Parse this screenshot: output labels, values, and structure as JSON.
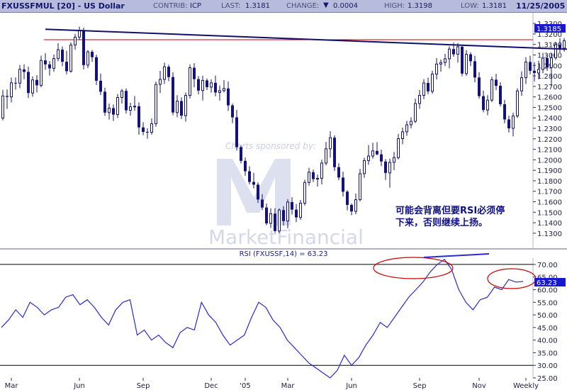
{
  "header": {
    "symbol": "FXUSSFMUL [20] - US Dollar",
    "contrib_label": "CONTRIB:",
    "contrib_value": "ICP",
    "last_label": "LAST:",
    "last_value": "1.3181",
    "change_label": "CHANGE:",
    "change_value": "0.0004",
    "high_label": "HIGH:",
    "high_value": "1.3198",
    "low_label": "LOW:",
    "low_value": "1.3181",
    "date": "11/25/2005"
  },
  "watermark": {
    "sponsor": "Charts sponsored by:",
    "brand": "MarketFinancial"
  },
  "annotation": {
    "line1": "可能会背离但要RSI必须停",
    "line2": "下来，否则继续上扬。"
  },
  "colors": {
    "candle": "#12127a",
    "resistance": "#cc0000",
    "trendline": "#10106a",
    "rsi_line": "#2a2ad0",
    "ellipse": "#cc0000",
    "header_bg": "#b8bcdc",
    "price_box": "#1818cc"
  },
  "chart_data": [
    {
      "type": "candlestick",
      "title": "FXUSSFMUL [20] - US Dollar",
      "ylim": [
        1.1225,
        1.3375
      ],
      "yticks": [
        "1.3300",
        "1.3200",
        "1.3100",
        "1.3000",
        "1.2900",
        "1.2800",
        "1.2700",
        "1.2600",
        "1.2500",
        "1.2400",
        "1.2300",
        "1.2200",
        "1.2100",
        "1.2000",
        "1.1900",
        "1.1800",
        "1.1700",
        "1.1600",
        "1.1500",
        "1.1400",
        "1.1300"
      ],
      "current_price_label": "1.3185",
      "resistance_level": 1.3145,
      "trendline": {
        "from_index": 10,
        "from_value": 1.3245,
        "to_index": 149,
        "to_value": 1.3029
      },
      "ohlc": [
        [
          1.2398,
          1.2668,
          1.2376,
          1.2609
        ],
        [
          1.2609,
          1.2671,
          1.2486,
          1.26
        ],
        [
          1.26,
          1.2784,
          1.2547,
          1.2734
        ],
        [
          1.2734,
          1.2786,
          1.2669,
          1.2731
        ],
        [
          1.2731,
          1.2905,
          1.2682,
          1.2862
        ],
        [
          1.2862,
          1.2911,
          1.2768,
          1.2838
        ],
        [
          1.2838,
          1.2889,
          1.2589,
          1.2637
        ],
        [
          1.2637,
          1.2795,
          1.2602,
          1.2762
        ],
        [
          1.2762,
          1.2807,
          1.2643,
          1.271
        ],
        [
          1.271,
          1.2993,
          1.2691,
          1.2948
        ],
        [
          1.2948,
          1.3017,
          1.2858,
          1.291
        ],
        [
          1.291,
          1.2942,
          1.2803,
          1.2872
        ],
        [
          1.2872,
          1.3003,
          1.2841,
          1.2965
        ],
        [
          1.2965,
          1.3111,
          1.2941,
          1.305
        ],
        [
          1.305,
          1.3081,
          1.2893,
          1.2935
        ],
        [
          1.2935,
          1.304,
          1.2815,
          1.2845
        ],
        [
          1.2845,
          1.312,
          1.283,
          1.3095
        ],
        [
          1.3095,
          1.3201,
          1.305,
          1.317
        ],
        [
          1.317,
          1.327,
          1.3143,
          1.3235
        ],
        [
          1.3235,
          1.326,
          1.2862,
          1.2903
        ],
        [
          1.2903,
          1.3046,
          1.2874,
          1.303
        ],
        [
          1.303,
          1.3047,
          1.2934,
          1.2978
        ],
        [
          1.2978,
          1.3003,
          1.2714,
          1.2754
        ],
        [
          1.2754,
          1.2822,
          1.2618,
          1.2649
        ],
        [
          1.2649,
          1.2687,
          1.2419,
          1.245
        ],
        [
          1.245,
          1.2536,
          1.2383,
          1.2493
        ],
        [
          1.2493,
          1.2528,
          1.2371,
          1.2431
        ],
        [
          1.2431,
          1.2627,
          1.2398,
          1.2594
        ],
        [
          1.2594,
          1.2674,
          1.2537,
          1.2657
        ],
        [
          1.2657,
          1.2681,
          1.2442,
          1.2472
        ],
        [
          1.2472,
          1.2543,
          1.2421,
          1.2505
        ],
        [
          1.2505,
          1.2608,
          1.2467,
          1.2511
        ],
        [
          1.2511,
          1.2548,
          1.2239,
          1.2309
        ],
        [
          1.2309,
          1.2358,
          1.2236,
          1.2266
        ],
        [
          1.2266,
          1.2301,
          1.2201,
          1.2262
        ],
        [
          1.2262,
          1.2395,
          1.224,
          1.2344
        ],
        [
          1.2344,
          1.2746,
          1.2315,
          1.2719
        ],
        [
          1.2719,
          1.2848,
          1.2636,
          1.2767
        ],
        [
          1.2767,
          1.2926,
          1.2723,
          1.2887
        ],
        [
          1.2887,
          1.2907,
          1.275,
          1.2789
        ],
        [
          1.2789,
          1.2835,
          1.2425,
          1.2451
        ],
        [
          1.2451,
          1.2616,
          1.2406,
          1.256
        ],
        [
          1.256,
          1.2596,
          1.2389,
          1.2421
        ],
        [
          1.2421,
          1.2642,
          1.2364,
          1.2614
        ],
        [
          1.2614,
          1.291,
          1.2585,
          1.2878
        ],
        [
          1.2878,
          1.2921,
          1.2692,
          1.2769
        ],
        [
          1.2769,
          1.2799,
          1.2624,
          1.266
        ],
        [
          1.266,
          1.2802,
          1.2566,
          1.2757
        ],
        [
          1.2757,
          1.2776,
          1.2664,
          1.2693
        ],
        [
          1.2693,
          1.2767,
          1.264,
          1.2734
        ],
        [
          1.2734,
          1.2803,
          1.2605,
          1.2642
        ],
        [
          1.2642,
          1.2709,
          1.2565,
          1.2659
        ],
        [
          1.2659,
          1.276,
          1.2643,
          1.268
        ],
        [
          1.268,
          1.2747,
          1.2466,
          1.2519
        ],
        [
          1.2519,
          1.2536,
          1.2349,
          1.2405
        ],
        [
          1.2405,
          1.2476,
          1.2088,
          1.2121
        ],
        [
          1.2121,
          1.2137,
          1.1966,
          1.199
        ],
        [
          1.199,
          1.2021,
          1.1849,
          1.1891
        ],
        [
          1.1891,
          1.1939,
          1.1766,
          1.1789
        ],
        [
          1.1789,
          1.1877,
          1.1728,
          1.1763
        ],
        [
          1.1763,
          1.1785,
          1.1589,
          1.1621
        ],
        [
          1.1621,
          1.1673,
          1.152,
          1.1545
        ],
        [
          1.1545,
          1.1583,
          1.1376,
          1.1394
        ],
        [
          1.1394,
          1.1538,
          1.135,
          1.1487
        ],
        [
          1.1487,
          1.1539,
          1.1304,
          1.1321
        ],
        [
          1.1321,
          1.1537,
          1.13,
          1.1521
        ],
        [
          1.1521,
          1.1558,
          1.1373,
          1.1416
        ],
        [
          1.1416,
          1.1625,
          1.1347,
          1.1597
        ],
        [
          1.1597,
          1.1643,
          1.1478,
          1.1525
        ],
        [
          1.1525,
          1.1578,
          1.1406,
          1.1451
        ],
        [
          1.1451,
          1.1617,
          1.1428,
          1.1587
        ],
        [
          1.1587,
          1.1811,
          1.1564,
          1.1784
        ],
        [
          1.1784,
          1.1924,
          1.1754,
          1.1882
        ],
        [
          1.1882,
          1.1907,
          1.1788,
          1.1816
        ],
        [
          1.1816,
          1.186,
          1.1746,
          1.1823
        ],
        [
          1.1823,
          1.2001,
          1.1766,
          1.1969
        ],
        [
          1.1969,
          1.2171,
          1.1947,
          1.2105
        ],
        [
          1.2105,
          1.2273,
          1.202,
          1.2211
        ],
        [
          1.2211,
          1.2233,
          1.1894,
          1.193
        ],
        [
          1.193,
          1.1967,
          1.1806,
          1.1831
        ],
        [
          1.1831,
          1.1887,
          1.165,
          1.1696
        ],
        [
          1.1696,
          1.171,
          1.1517,
          1.157
        ],
        [
          1.157,
          1.1584,
          1.1472,
          1.1508
        ],
        [
          1.1508,
          1.1679,
          1.148,
          1.162
        ],
        [
          1.162,
          1.1913,
          1.1603,
          1.1868
        ],
        [
          1.1868,
          1.202,
          1.1828,
          1.1993
        ],
        [
          1.1993,
          1.214,
          1.1953,
          1.2036
        ],
        [
          1.2036,
          1.2163,
          1.2011,
          1.2085
        ],
        [
          1.2085,
          1.2168,
          1.2042,
          1.2052
        ],
        [
          1.2052,
          1.2097,
          1.194,
          1.1984
        ],
        [
          1.1984,
          1.2008,
          1.1807,
          1.1875
        ],
        [
          1.1875,
          1.2011,
          1.1735,
          1.1976
        ],
        [
          1.1976,
          1.2075,
          1.19,
          1.2021
        ],
        [
          1.2021,
          1.2248,
          1.2003,
          1.2202
        ],
        [
          1.2202,
          1.2307,
          1.2148,
          1.2267
        ],
        [
          1.2267,
          1.2371,
          1.2229,
          1.2334
        ],
        [
          1.2334,
          1.2405,
          1.23,
          1.2367
        ],
        [
          1.2367,
          1.2584,
          1.2351,
          1.2537
        ],
        [
          1.2537,
          1.2666,
          1.2486,
          1.2614
        ],
        [
          1.2614,
          1.2769,
          1.2578,
          1.2733
        ],
        [
          1.2733,
          1.2784,
          1.2625,
          1.2653
        ],
        [
          1.2653,
          1.2849,
          1.263,
          1.2818
        ],
        [
          1.2818,
          1.297,
          1.2766,
          1.2913
        ],
        [
          1.2913,
          1.2957,
          1.284,
          1.2928
        ],
        [
          1.2928,
          1.3011,
          1.2894,
          1.2963
        ],
        [
          1.2963,
          1.3083,
          1.2871,
          1.3056
        ],
        [
          1.3056,
          1.3117,
          1.2983,
          1.3006
        ],
        [
          1.3006,
          1.3115,
          1.2926,
          1.3078
        ],
        [
          1.3078,
          1.309,
          1.2796,
          1.2822
        ],
        [
          1.2822,
          1.3047,
          1.2801,
          1.3006
        ],
        [
          1.3006,
          1.3025,
          1.2894,
          1.294
        ],
        [
          1.294,
          1.2991,
          1.2739,
          1.2785
        ],
        [
          1.2785,
          1.2835,
          1.2584,
          1.2607
        ],
        [
          1.2607,
          1.266,
          1.2453,
          1.2475
        ],
        [
          1.2475,
          1.2617,
          1.2425,
          1.2569
        ],
        [
          1.2569,
          1.2792,
          1.2549,
          1.2764
        ],
        [
          1.2764,
          1.282,
          1.2665,
          1.2706
        ],
        [
          1.2706,
          1.2739,
          1.2509,
          1.253
        ],
        [
          1.253,
          1.2572,
          1.2348,
          1.2385
        ],
        [
          1.2385,
          1.2421,
          1.226,
          1.23
        ],
        [
          1.23,
          1.245,
          1.2223,
          1.2418
        ],
        [
          1.2418,
          1.2682,
          1.2399,
          1.2657
        ],
        [
          1.2657,
          1.2844,
          1.261,
          1.2783
        ],
        [
          1.2783,
          1.2979,
          1.2723,
          1.2933
        ],
        [
          1.2933,
          1.2992,
          1.2815,
          1.2849
        ],
        [
          1.2849,
          1.293,
          1.2747,
          1.2828
        ],
        [
          1.2828,
          1.2945,
          1.2768,
          1.2861
        ],
        [
          1.2861,
          1.302,
          1.2825,
          1.297
        ],
        [
          1.297,
          1.3004,
          1.2848,
          1.288
        ],
        [
          1.288,
          1.302,
          1.2703,
          1.2972
        ],
        [
          1.2972,
          1.3124,
          1.2952,
          1.3097
        ],
        [
          1.3097,
          1.3159,
          1.3022,
          1.3064
        ],
        [
          1.3064,
          1.316,
          1.3031,
          1.3136
        ],
        [
          1.3136,
          1.3293,
          1.3103,
          1.3198
        ],
        [
          1.3198,
          1.3237,
          1.3158,
          1.3181
        ]
      ],
      "xlabels": [
        {
          "index": 2,
          "label": "Mar"
        },
        {
          "index": 18,
          "label": "Jun"
        },
        {
          "index": 33,
          "label": "Sep"
        },
        {
          "index": 49,
          "label": "Dec"
        },
        {
          "index": 57,
          "label": "'05"
        },
        {
          "index": 67,
          "label": "Mar"
        },
        {
          "index": 82,
          "label": "Jun"
        },
        {
          "index": 98,
          "label": "Sep"
        },
        {
          "index": 112,
          "label": "Nov"
        },
        {
          "index": 123,
          "label": "Weekly"
        }
      ]
    },
    {
      "type": "line",
      "title": "RSI (FXUSSF,14) = 63.23",
      "series": [
        {
          "name": "RSI (FXUSSF,14)",
          "values": [
            45,
            48,
            52,
            49,
            55,
            53,
            50,
            52,
            53,
            57,
            58,
            54,
            56,
            53,
            49,
            46,
            52,
            55,
            56,
            42,
            44,
            40,
            42,
            39,
            37,
            43,
            45,
            44,
            55,
            50,
            47,
            42,
            38,
            40,
            42,
            49,
            55,
            53,
            48,
            45,
            40,
            37,
            34,
            31,
            29,
            27,
            25,
            28,
            34,
            30,
            33,
            38,
            42,
            47,
            45,
            49,
            53,
            57,
            60,
            63,
            67,
            70,
            72,
            68,
            60,
            55,
            52,
            56,
            57,
            61,
            60,
            64,
            63,
            63.23
          ]
        }
      ],
      "ylim": [
        25,
        72.5
      ],
      "yticks": [
        "70.00",
        "65.00",
        "60.00",
        "55.00",
        "50.00",
        "45.00",
        "40.00",
        "35.00",
        "30.00",
        "25.00"
      ],
      "upper_band": 70,
      "lower_band": 30,
      "current_value_label": "63.23"
    }
  ]
}
